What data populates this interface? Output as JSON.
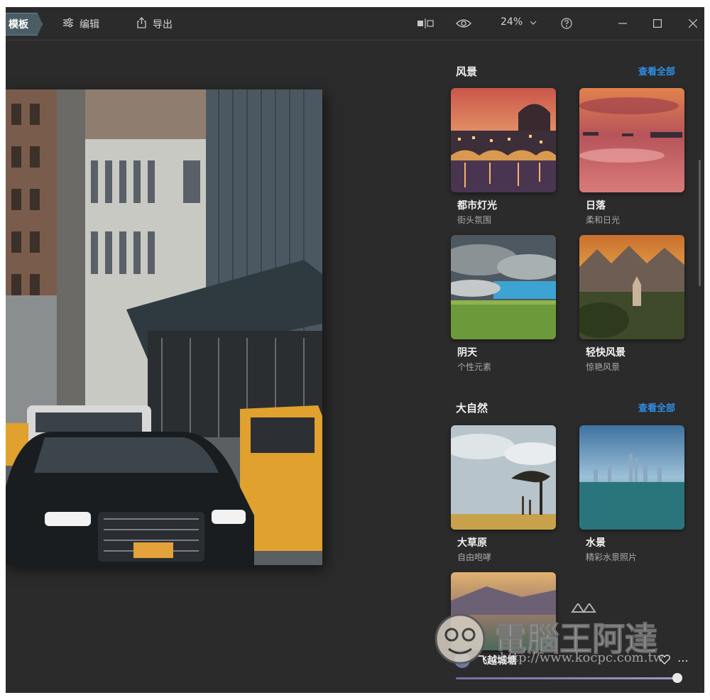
{
  "toolbar": {
    "tabs": [
      {
        "label": "模板",
        "icon": "template-icon",
        "active": true
      },
      {
        "label": "编辑",
        "icon": "sliders-icon",
        "active": false
      },
      {
        "label": "导出",
        "icon": "export-icon",
        "active": false
      }
    ],
    "zoom": "24%",
    "icons": [
      "compare-icon",
      "eye-icon",
      "help-icon",
      "minimize-icon",
      "maximize-icon",
      "close-icon"
    ]
  },
  "panel": {
    "sections": [
      {
        "title": "风景",
        "see_all": "查看全部",
        "cards": [
          {
            "title": "都市灯光",
            "subtitle": "街头氛围"
          },
          {
            "title": "日落",
            "subtitle": "柔和日光"
          },
          {
            "title": "阴天",
            "subtitle": "个性元素"
          },
          {
            "title": "轻快风景",
            "subtitle": "惊艳风景"
          }
        ]
      },
      {
        "title": "大自然",
        "see_all": "查看全部",
        "cards": [
          {
            "title": "大草原",
            "subtitle": "自由咆哮"
          },
          {
            "title": "水景",
            "subtitle": "精彩水景照片"
          },
          {
            "title": "飞越城塘",
            "subtitle": ""
          }
        ]
      }
    ]
  },
  "watermark": {
    "text": "電腦王阿達",
    "url": "http://www.kocpc.com.tw"
  },
  "colors": {
    "accent": "#2f8fe6",
    "background": "#2b2b2b",
    "active_tab": "#4a5c64"
  }
}
